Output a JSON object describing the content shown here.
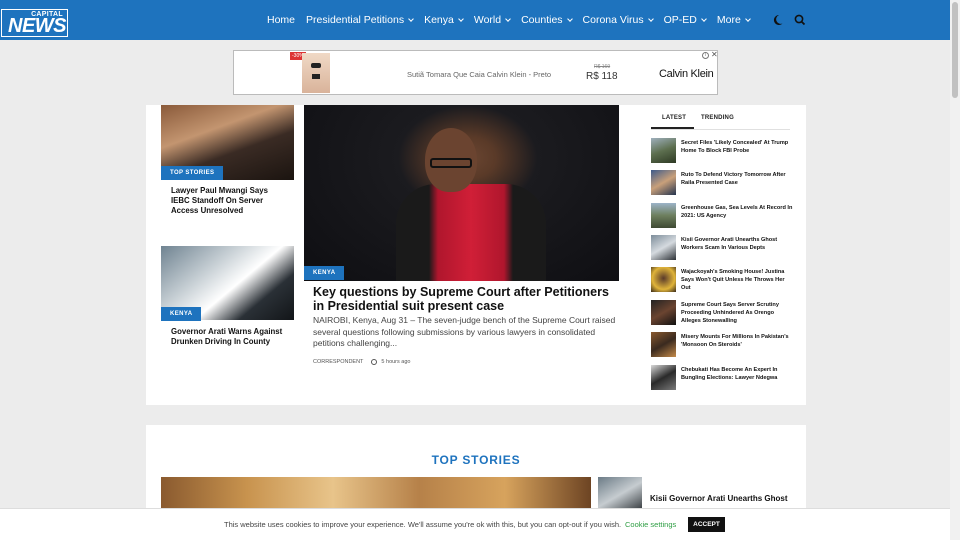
{
  "header": {
    "logo_top": "CAPITAL",
    "logo_main": "NEWS",
    "nav": [
      {
        "label": "Home",
        "dropdown": false
      },
      {
        "label": "Presidential Petitions",
        "dropdown": true
      },
      {
        "label": "Kenya",
        "dropdown": true
      },
      {
        "label": "World",
        "dropdown": true
      },
      {
        "label": "Counties",
        "dropdown": true
      },
      {
        "label": "Corona Virus",
        "dropdown": true
      },
      {
        "label": "OP-ED",
        "dropdown": true
      },
      {
        "label": "More",
        "dropdown": true
      }
    ],
    "icons": [
      "moon-icon",
      "search-icon"
    ],
    "bg_color": "#1e73be"
  },
  "ad": {
    "discount": "-30%",
    "product": "Sutiã Tomara Que Caia Calvin Klein - Preto",
    "old_price": "R$ 169",
    "price": "R$ 118",
    "brand": "Calvin Klein"
  },
  "featured": {
    "left_cards": [
      {
        "tag": "TOP STORIES",
        "title": "Lawyer Paul Mwangi Says IEBC Standoff On Server Access Unresolved"
      },
      {
        "tag": "KENYA",
        "title": "Governor Arati Warns Against Drunken Driving In County"
      }
    ],
    "main": {
      "tag": "KENYA",
      "title": "Key questions by Supreme Court after Petitioners in Presidential suit present case",
      "excerpt": "NAIROBI, Kenya, Aug 31 – The seven-judge bench of the Supreme Court raised several questions following submissions by various lawyers in consolidated petitions challenging...",
      "author": "CORRESPONDENT",
      "time": "5 hours ago"
    }
  },
  "sidebar": {
    "tabs": [
      "LATEST",
      "TRENDING"
    ],
    "items": [
      "Secret Files 'Likely Concealed' At Trump Home To Block FBI Probe",
      "Ruto To Defend Victory Tomorrow After Raila Presented Case",
      "Greenhouse Gas, Sea Levels At Record In 2021: US Agency",
      "Kisii Governor Arati Unearths Ghost Workers Scam In Various Depts",
      "Wajackoyah's Smoking House! Justina Says Won't Quit Unless He Throws Her Out",
      "Supreme Court Says Server Scrutiny Proceeding Unhindered As Orengo Alleges Stonewalling",
      "Misery Mounts For Millions In Pakistan's 'Monsoon On Steroids'",
      "Chebukati Has Become An Expert In Bungling Elections: Lawyer Ndegwa"
    ]
  },
  "top_stories": {
    "heading": "TOP STORIES",
    "side_title": "Kisii Governor Arati Unearths Ghost"
  },
  "cookie": {
    "message": "This website uses cookies to improve your experience. We'll assume you're ok with this, but you can opt-out if you wish.",
    "settings": "Cookie settings",
    "accept": "ACCEPT"
  }
}
